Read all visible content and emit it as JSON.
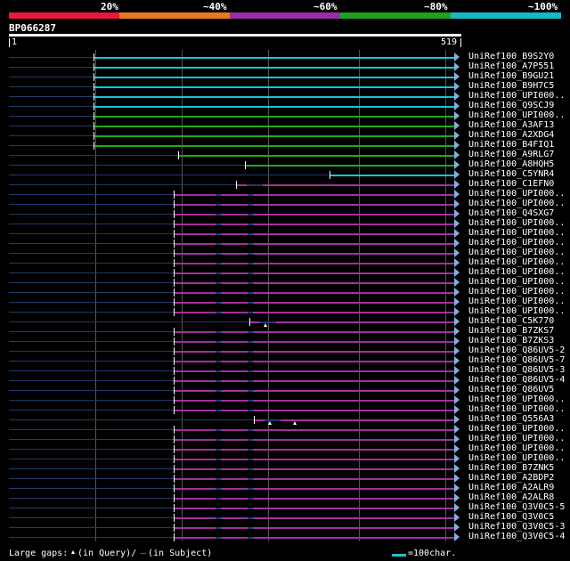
{
  "header": {
    "scale_labels": [
      "20%",
      "~40%",
      "~60%",
      "~80%",
      "~100%"
    ],
    "scale_colors": [
      "#e8173e",
      "#e87820",
      "#9a2ea6",
      "#1fa01f",
      "#16b8c8"
    ],
    "query_id": "BP066287",
    "axis_start": "1",
    "axis_end": "519"
  },
  "colors": {
    "cyan": "#16c4d8",
    "green": "#1faa1f",
    "purple": "#a2309c",
    "dark_track": "#22386a",
    "arrow": "#7fb0e0"
  },
  "hits": [
    {
      "label": "UniRef100_B9S2Y0",
      "color": "cyan",
      "start": 0.19
    },
    {
      "label": "UniRef100_A7P551",
      "color": "cyan",
      "start": 0.19
    },
    {
      "label": "UniRef100_B9GU21",
      "color": "cyan",
      "start": 0.19
    },
    {
      "label": "UniRef100_B9H7C5",
      "color": "cyan",
      "start": 0.19
    },
    {
      "label": "UniRef100_UPI000..",
      "color": "cyan",
      "start": 0.19
    },
    {
      "label": "UniRef100_Q9SCJ9",
      "color": "cyan",
      "start": 0.19
    },
    {
      "label": "UniRef100_UPI000..",
      "color": "green",
      "start": 0.19
    },
    {
      "label": "UniRef100_A3AF13",
      "color": "green",
      "start": 0.19
    },
    {
      "label": "UniRef100_A2XDG4",
      "color": "green",
      "start": 0.19
    },
    {
      "label": "UniRef100_B4FIQ1",
      "color": "green",
      "start": 0.19
    },
    {
      "label": "UniRef100_A9RLG7",
      "color": "green",
      "start": 0.38
    },
    {
      "label": "UniRef100_A8HQH5",
      "color": "green",
      "start": 0.53
    },
    {
      "label": "UniRef100_C5YNR4",
      "color": "cyan",
      "start": 0.72
    },
    {
      "label": "UniRef100_C1EFN0",
      "color": "purple",
      "start": 0.51
    },
    {
      "label": "UniRef100_UPI000..",
      "color": "purple",
      "start": 0.37
    },
    {
      "label": "UniRef100_UPI000..",
      "color": "purple",
      "start": 0.37
    },
    {
      "label": "UniRef100_Q4SXG7",
      "color": "purple",
      "start": 0.37
    },
    {
      "label": "UniRef100_UPI000..",
      "color": "purple",
      "start": 0.37
    },
    {
      "label": "UniRef100_UPI000..",
      "color": "purple",
      "start": 0.37
    },
    {
      "label": "UniRef100_UPI000..",
      "color": "purple",
      "start": 0.37
    },
    {
      "label": "UniRef100_UPI000..",
      "color": "purple",
      "start": 0.37
    },
    {
      "label": "UniRef100_UPI000..",
      "color": "purple",
      "start": 0.37
    },
    {
      "label": "UniRef100_UPI000..",
      "color": "purple",
      "start": 0.37
    },
    {
      "label": "UniRef100_UPI000..",
      "color": "purple",
      "start": 0.37
    },
    {
      "label": "UniRef100_UPI000..",
      "color": "purple",
      "start": 0.37
    },
    {
      "label": "UniRef100_UPI000..",
      "color": "purple",
      "start": 0.37
    },
    {
      "label": "UniRef100_UPI000..",
      "color": "purple",
      "start": 0.37
    },
    {
      "label": "UniRef100_C5K770",
      "color": "purple",
      "start": 0.54,
      "caret": true
    },
    {
      "label": "UniRef100_B7ZKS7",
      "color": "purple",
      "start": 0.37
    },
    {
      "label": "UniRef100_B7ZKS3",
      "color": "purple",
      "start": 0.37
    },
    {
      "label": "UniRef100_Q86UV5-2",
      "color": "purple",
      "start": 0.37
    },
    {
      "label": "UniRef100_Q86UV5-7",
      "color": "purple",
      "start": 0.37
    },
    {
      "label": "UniRef100_Q86UV5-3",
      "color": "purple",
      "start": 0.37
    },
    {
      "label": "UniRef100_Q86UV5-4",
      "color": "purple",
      "start": 0.37
    },
    {
      "label": "UniRef100_Q86UV5",
      "color": "purple",
      "start": 0.37
    },
    {
      "label": "UniRef100_UPI000..",
      "color": "purple",
      "start": 0.37
    },
    {
      "label": "UniRef100_UPI000..",
      "color": "purple",
      "start": 0.37
    },
    {
      "label": "UniRef100_Q556A3",
      "color": "purple",
      "start": 0.55,
      "caret": true
    },
    {
      "label": "UniRef100_UPI000..",
      "color": "purple",
      "start": 0.37
    },
    {
      "label": "UniRef100_UPI000..",
      "color": "purple",
      "start": 0.37
    },
    {
      "label": "UniRef100_UPI000..",
      "color": "purple",
      "start": 0.37
    },
    {
      "label": "UniRef100_UPI000..",
      "color": "purple",
      "start": 0.37
    },
    {
      "label": "UniRef100_B7ZNK5",
      "color": "purple",
      "start": 0.37
    },
    {
      "label": "UniRef100_A2BDP2",
      "color": "purple",
      "start": 0.37
    },
    {
      "label": "UniRef100_A2ALR9",
      "color": "purple",
      "start": 0.37
    },
    {
      "label": "UniRef100_A2ALR8",
      "color": "purple",
      "start": 0.37
    },
    {
      "label": "UniRef100_Q3V0C5-5",
      "color": "purple",
      "start": 0.37
    },
    {
      "label": "UniRef100_Q3V0C5",
      "color": "purple",
      "start": 0.37
    },
    {
      "label": "UniRef100_Q3V0C5-3",
      "color": "purple",
      "start": 0.37
    },
    {
      "label": "UniRef100_Q3V0C5-4",
      "color": "purple",
      "start": 0.37
    }
  ],
  "footer": {
    "gaps_label": "Large gaps:",
    "query_gap_text": "(in Query)/",
    "subject_gap_symbol": "–",
    "subject_gap_text": " (in Subject)",
    "scale_text": "=100char."
  }
}
